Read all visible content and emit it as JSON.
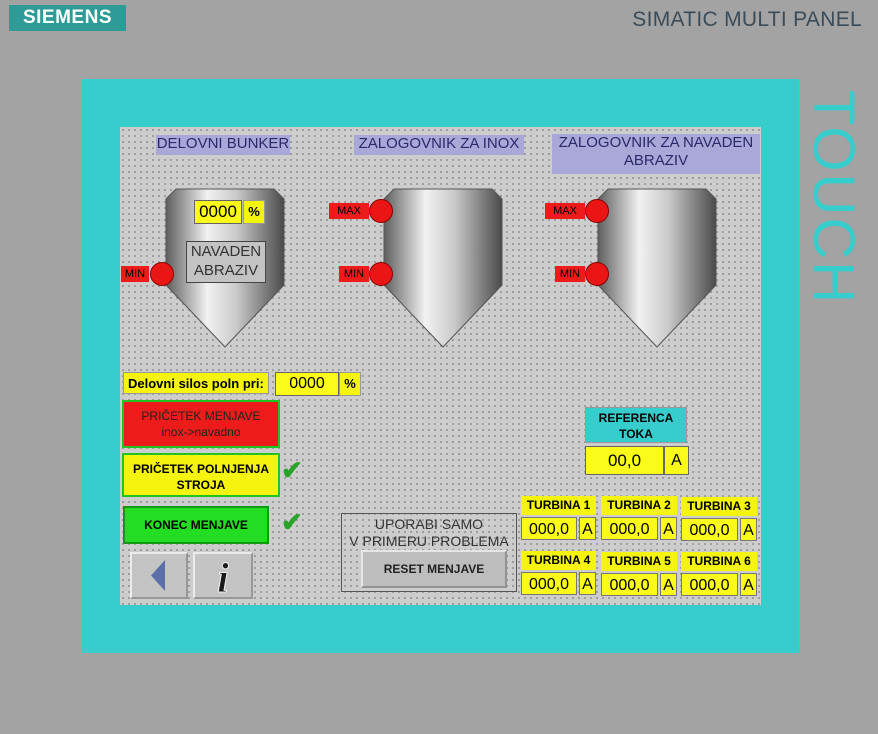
{
  "header": {
    "brand": "SIEMENS",
    "model": "SIMATIC MULTI PANEL",
    "touch": "TOUCH"
  },
  "colors": {
    "bezel": "#37cdcc",
    "alarm_red": "#ea1616",
    "field_yellow": "#fbfb1a",
    "title_lavender": "#a9a8d8",
    "start_green": "#22dd22"
  },
  "silos": {
    "delovni": {
      "title": "DELOVNI BUNKER",
      "level": "0000",
      "level_unit": "%",
      "material_line1": "NAVADEN",
      "material_line2": "ABRAZIV",
      "min_label": "MIN"
    },
    "inox": {
      "title": "ZALOGOVNIK ZA INOX",
      "max_label": "MAX",
      "min_label": "MIN"
    },
    "navaden": {
      "title_line1": "ZALOGOVNIK ZA NAVADEN",
      "title_line2": "ABRAZIV",
      "max_label": "MAX",
      "min_label": "MIN"
    }
  },
  "fill": {
    "label": "Delovni silos poln pri:",
    "value": "0000",
    "unit": "%"
  },
  "buttons": {
    "start_change_line1": "PRIČETEK MENJAVE",
    "start_change_line2": "inox->navadno",
    "start_fill_line1": "PRIČETEK POLNJENJA",
    "start_fill_line2": "STROJA",
    "end_change": "KONEC MENJAVE",
    "reset": "RESET MENJAVE"
  },
  "reset_note": {
    "line1": "UPORABI SAMO",
    "line2": "V PRIMERU PROBLEMA"
  },
  "reference": {
    "label_line1": "REFERENCA",
    "label_line2": "TOKA",
    "value": "00,0",
    "unit": "A"
  },
  "turbines": [
    {
      "label": "TURBINA 1",
      "value": "000,0",
      "unit": "A"
    },
    {
      "label": "TURBINA 2",
      "value": "000,0",
      "unit": "A"
    },
    {
      "label": "TURBINA 3",
      "value": "000,0",
      "unit": "A"
    },
    {
      "label": "TURBINA 4",
      "value": "000,0",
      "unit": "A"
    },
    {
      "label": "TURBINA 5",
      "value": "000,0",
      "unit": "A"
    },
    {
      "label": "TURBINA 6",
      "value": "000,0",
      "unit": "A"
    }
  ],
  "nav": {
    "back_icon": "back-arrow-icon",
    "info_icon": "info-icon",
    "info_glyph": "i"
  }
}
